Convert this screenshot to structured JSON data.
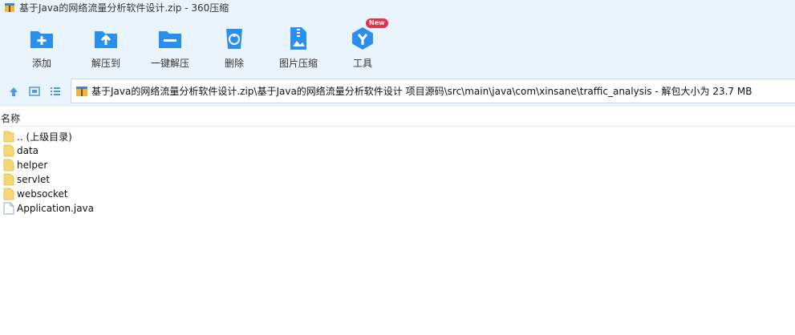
{
  "window": {
    "title": "基于Java的网络流量分析软件设计.zip - 360压缩",
    "app_icon": "archive-icon"
  },
  "toolbar": {
    "items": [
      {
        "label": "添加",
        "icon": "add-icon"
      },
      {
        "label": "解压到",
        "icon": "extract-to-icon"
      },
      {
        "label": "一键解压",
        "icon": "one-click-extract-icon"
      },
      {
        "label": "删除",
        "icon": "delete-icon"
      },
      {
        "label": "图片压缩",
        "icon": "image-compress-icon"
      },
      {
        "label": "工具",
        "icon": "tools-icon",
        "badge": "New"
      }
    ]
  },
  "address": {
    "path": "基于Java的网络流量分析软件设计.zip\\基于Java的网络流量分析软件设计 项目源码\\src\\main\\java\\com\\xinsane\\traffic_analysis - 解包大小为 23.7 MB"
  },
  "list": {
    "column_name": "名称",
    "items": [
      {
        "name": ".. (上级目录)",
        "type": "parent-folder"
      },
      {
        "name": "data",
        "type": "folder"
      },
      {
        "name": "helper",
        "type": "folder"
      },
      {
        "name": "servlet",
        "type": "folder"
      },
      {
        "name": "websocket",
        "type": "folder"
      },
      {
        "name": "Application.java",
        "type": "file"
      }
    ]
  },
  "colors": {
    "toolbar_bg": "#eaf4fd",
    "accent": "#2b8ff0",
    "badge": "#e8314a",
    "folder": "#f7d774"
  }
}
